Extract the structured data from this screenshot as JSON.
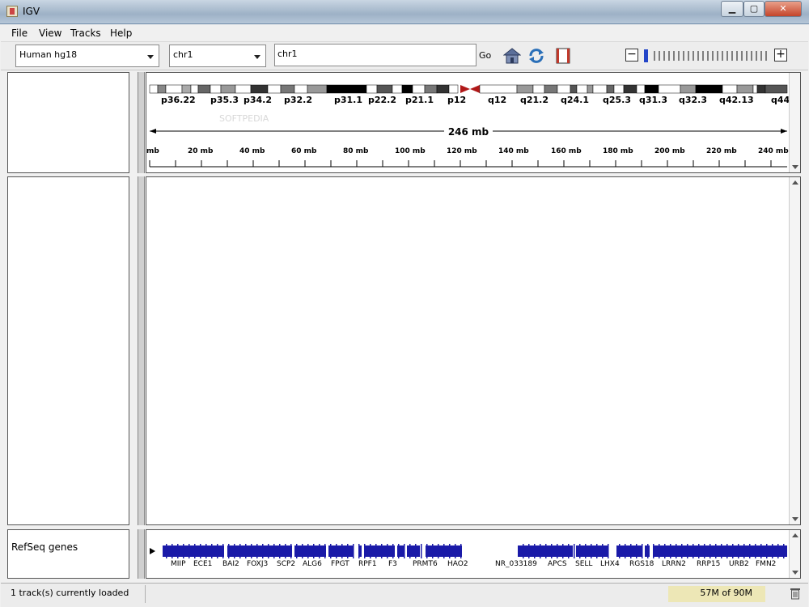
{
  "window": {
    "title": "IGV"
  },
  "menu": {
    "items": [
      "File",
      "View",
      "Tracks",
      "Help"
    ]
  },
  "toolbar": {
    "genome": "Human hg18",
    "chromosome": "chr1",
    "locus": "chr1",
    "go_label": "Go"
  },
  "ideogram": {
    "band_labels": [
      "p36.22",
      "p35.3",
      "p34.2",
      "p32.2",
      "p31.1",
      "p22.2",
      "p21.1",
      "p12",
      "q12",
      "q21.2",
      "q24.1",
      "q25.3",
      "q31.3",
      "q32.3",
      "q42.13",
      "q44"
    ],
    "centromere_color": "#b01818"
  },
  "ruler": {
    "span_label": "246 mb",
    "tick_labels": [
      "mb",
      "20 mb",
      "40 mb",
      "60 mb",
      "80 mb",
      "100 mb",
      "120 mb",
      "140 mb",
      "160 mb",
      "180 mb",
      "200 mb",
      "220 mb",
      "240 mb"
    ]
  },
  "tracks": {
    "refseq": {
      "name": "RefSeq genes",
      "color": "#1a1aa8",
      "gene_labels": [
        "MIIP",
        "ECE1",
        "BAI2",
        "FOXJ3",
        "SCP2",
        "ALG6",
        "FPGT",
        "RPF1",
        "F3",
        "PRMT6",
        "HAO2",
        "NR_033189",
        "APCS",
        "SELL",
        "LHX4",
        "RGS18",
        "LRRN2",
        "RRP15",
        "URB2",
        "FMN2"
      ]
    }
  },
  "status": {
    "message": "1 track(s) currently loaded",
    "memory": "57M of 90M"
  },
  "watermark": "SOFTPEDIA"
}
